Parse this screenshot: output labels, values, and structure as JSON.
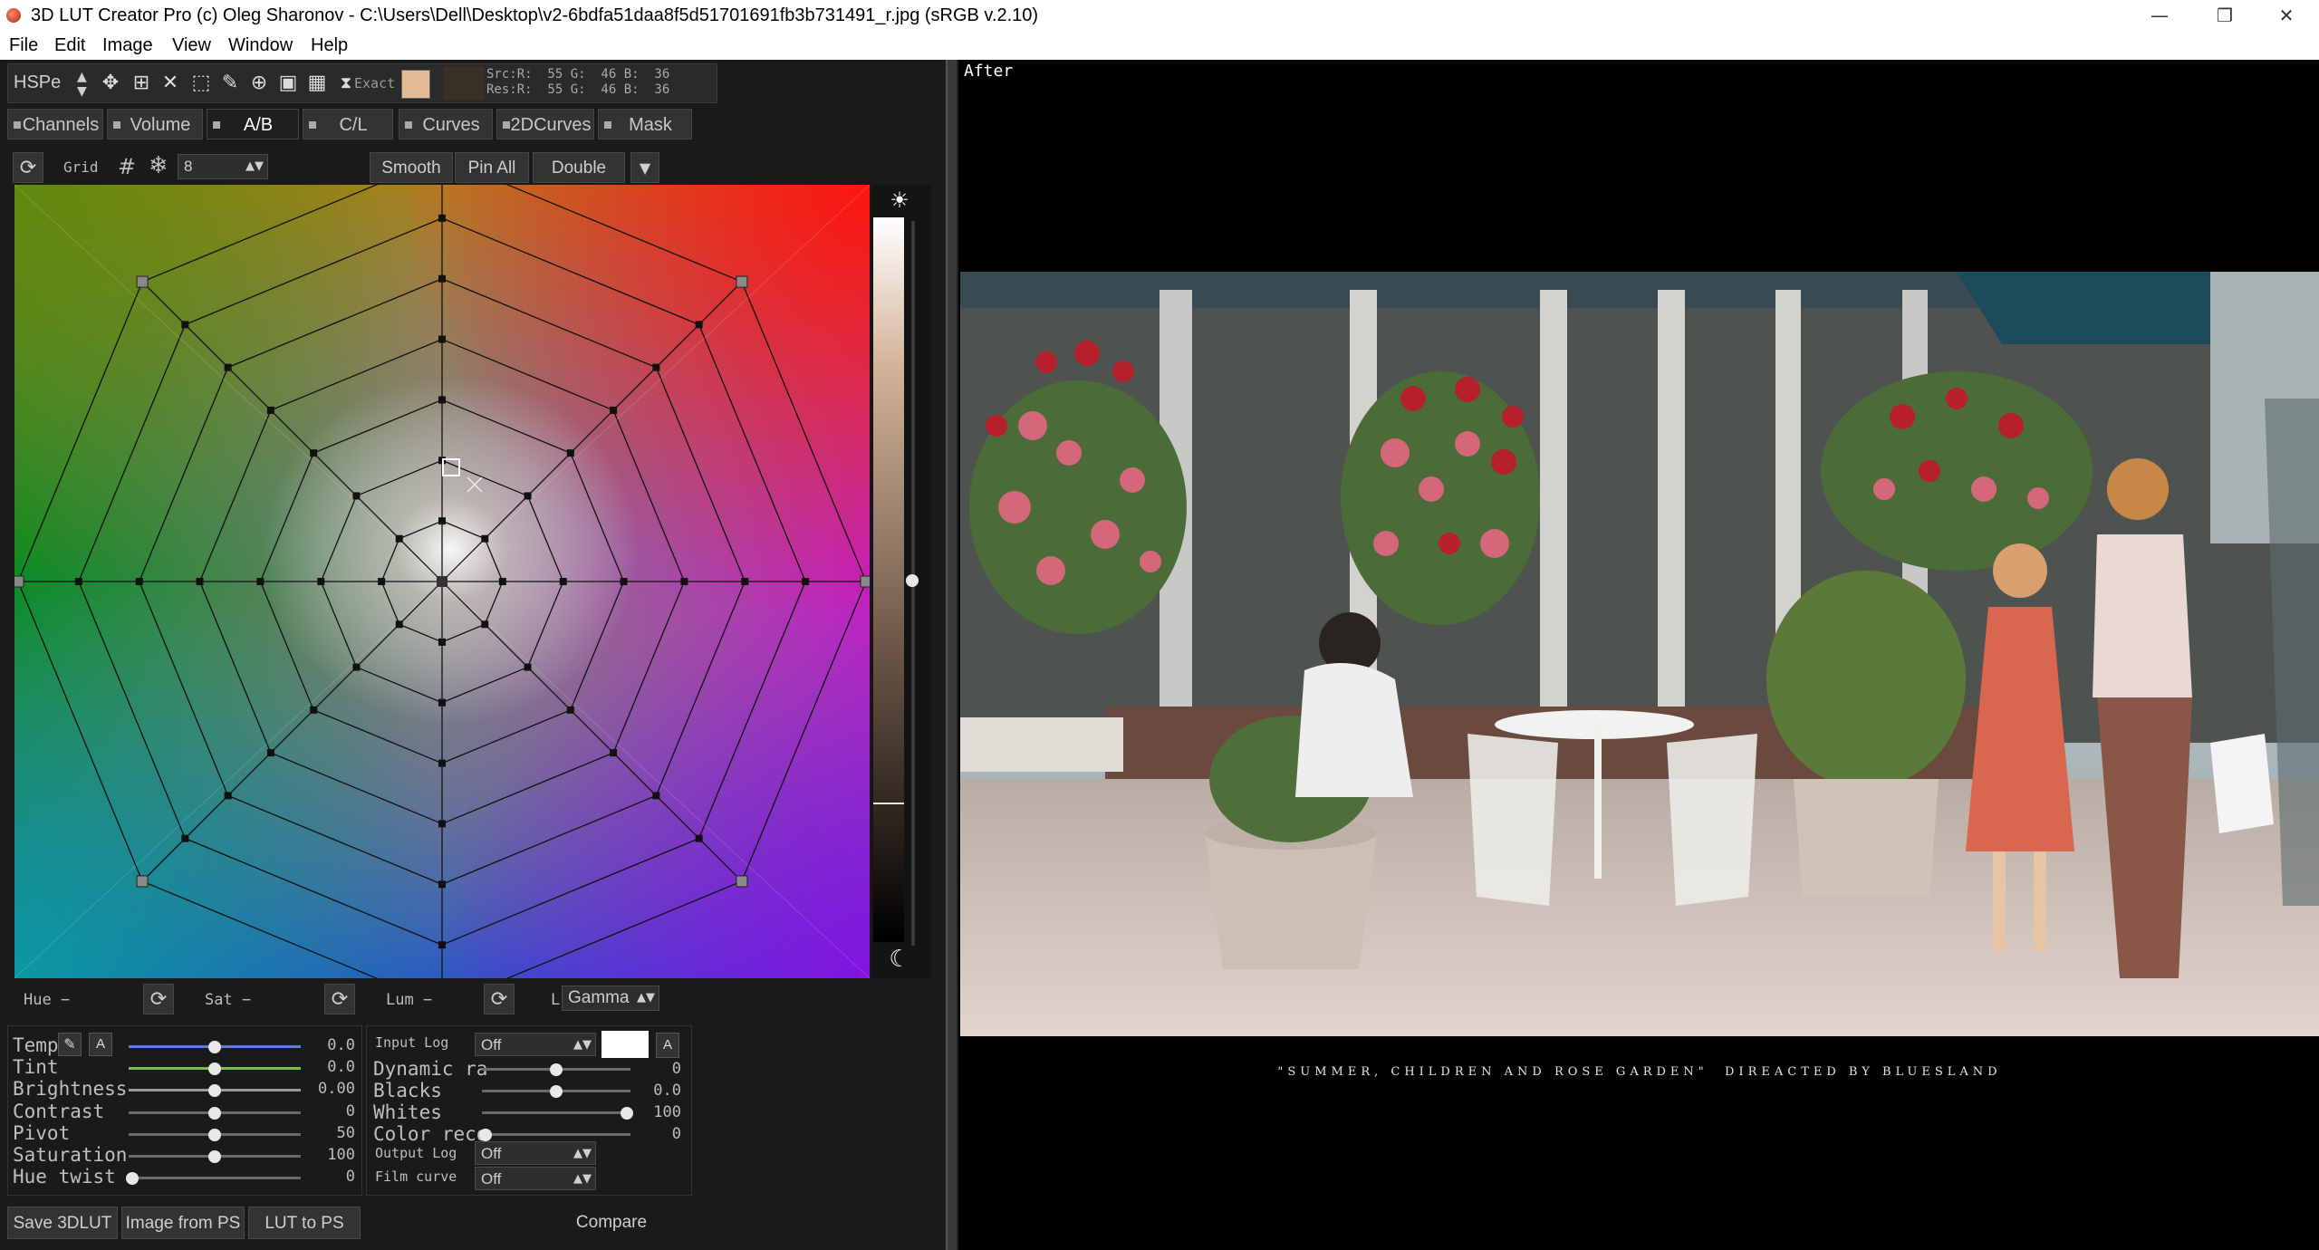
{
  "window": {
    "title": "3D LUT Creator Pro (c) Oleg Sharonov - C:\\Users\\Dell\\Desktop\\v2-6bdfa51daa8f5d51701691fb3b731491_r.jpg (sRGB v.2.10)",
    "minimize_glyph": "—",
    "maximize_glyph": "❐",
    "close_glyph": "✕"
  },
  "menu": [
    "File",
    "Edit",
    "Image",
    "View",
    "Window",
    "Help"
  ],
  "toolbar": {
    "mode": "HSPe",
    "exact_label": "Exact",
    "swatch_color": "#e3bb97",
    "src_readout": "Src:R:  55 G:  46 B:  36",
    "res_readout": "Res:R:  55 G:  46 B:  36"
  },
  "tabs": [
    "Channels",
    "Volume",
    "A/B",
    "C/L",
    "Curves",
    "2DCurves",
    "Mask"
  ],
  "active_tab": "A/B",
  "grid_bar": {
    "grid_label": "Grid",
    "grid_value": "8",
    "smooth": "Smooth",
    "pin_all": "Pin All",
    "double": "Double"
  },
  "wheel_footer": {
    "hue": "Hue −",
    "sat": "Sat −",
    "lum": "Lum −",
    "l": "L",
    "gamma": "Gamma"
  },
  "sliders": [
    {
      "label": "Temp",
      "value": "0.0",
      "pos": 0.5,
      "track": "#5a7fd6"
    },
    {
      "label": "Tint",
      "value": "0.0",
      "pos": 0.5,
      "track": "#7bbf4a"
    },
    {
      "label": "Brightness",
      "value": "0.00",
      "pos": 0.5,
      "track": "#9a9a9a"
    },
    {
      "label": "Contrast",
      "value": "0",
      "pos": 0.5,
      "track": "#6a6a6a"
    },
    {
      "label": "Pivot",
      "value": "50",
      "pos": 0.5,
      "track": "#6a6a6a"
    },
    {
      "label": "Saturation",
      "value": "100",
      "pos": 0.5,
      "track": "#6a6a6a"
    },
    {
      "label": "Hue twist",
      "value": "0",
      "pos": 0.02,
      "track": "#6a6a6a"
    }
  ],
  "right_controls": {
    "input_log_label": "Input Log",
    "input_log_value": "Off",
    "dynamic_range_label": "Dynamic ra",
    "dynamic_range_value": "0",
    "blacks_label": "Blacks",
    "blacks_value": "0.0",
    "whites_label": "Whites",
    "whites_value": "100",
    "color_recovery_label": "Color reco",
    "color_recovery_value": "0",
    "output_log_label": "Output Log",
    "output_log_value": "Off",
    "film_curve_label": "Film curve",
    "film_curve_value": "Off",
    "a_label": "A"
  },
  "bottom_buttons": {
    "save": "Save 3DLUT",
    "image_from_ps": "Image from PS",
    "lut_to_ps": "LUT to PS",
    "compare": "Compare"
  },
  "preview": {
    "label": "After",
    "caption": "\"SUMMER, CHILDREN AND ROSE GARDEN\"  DIREACTED BY BLUESLAND"
  }
}
